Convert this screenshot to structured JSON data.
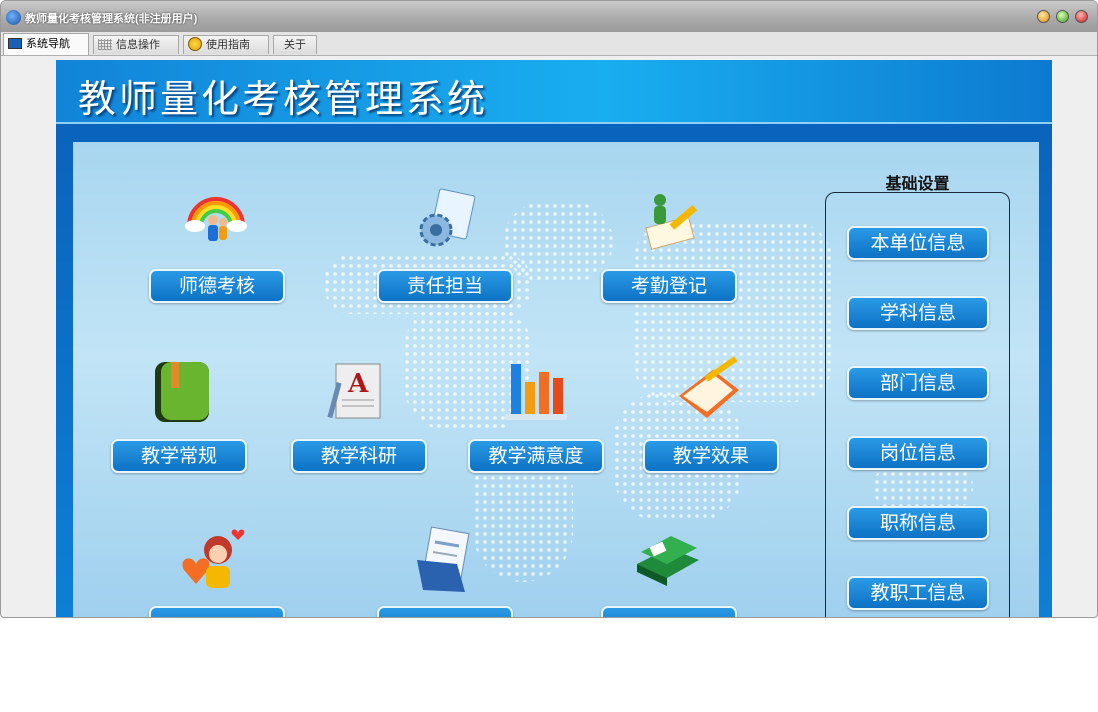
{
  "window": {
    "title": "教师量化考核管理系统(非注册用户)"
  },
  "tabs": [
    {
      "label": "系统导航",
      "icon": "monitor-icon",
      "active": true
    },
    {
      "label": "信息操作",
      "icon": "grid-icon",
      "active": false
    },
    {
      "label": "使用指南",
      "icon": "smiley-icon",
      "active": false
    },
    {
      "label": "关于",
      "icon": "",
      "active": false
    }
  ],
  "header": {
    "title": "教师量化考核管理系统"
  },
  "modules": [
    {
      "label": "师德考核",
      "icon": "rainbow-people-icon"
    },
    {
      "label": "责任担当",
      "icon": "gear-document-icon"
    },
    {
      "label": "考勤登记",
      "icon": "person-pencil-icon"
    },
    {
      "label": "教学常规",
      "icon": "green-book-icon"
    },
    {
      "label": "教学科研",
      "icon": "letter-a-document-icon"
    },
    {
      "label": "教学满意度",
      "icon": "bar-chart-icon"
    },
    {
      "label": "教学效果",
      "icon": "pencil-folder-icon"
    },
    {
      "label": "",
      "icon": "girl-hearts-icon"
    },
    {
      "label": "",
      "icon": "newspaper-icon"
    },
    {
      "label": "",
      "icon": "green-books-icon"
    }
  ],
  "settings": {
    "title": "基础设置",
    "items": [
      "本单位信息",
      "学科信息",
      "部门信息",
      "岗位信息",
      "职称信息",
      "教职工信息"
    ]
  },
  "colors": {
    "header_blue": "#1284d8",
    "button_blue": "#0d72c4",
    "panel_light_blue": "#a8d6f0"
  }
}
